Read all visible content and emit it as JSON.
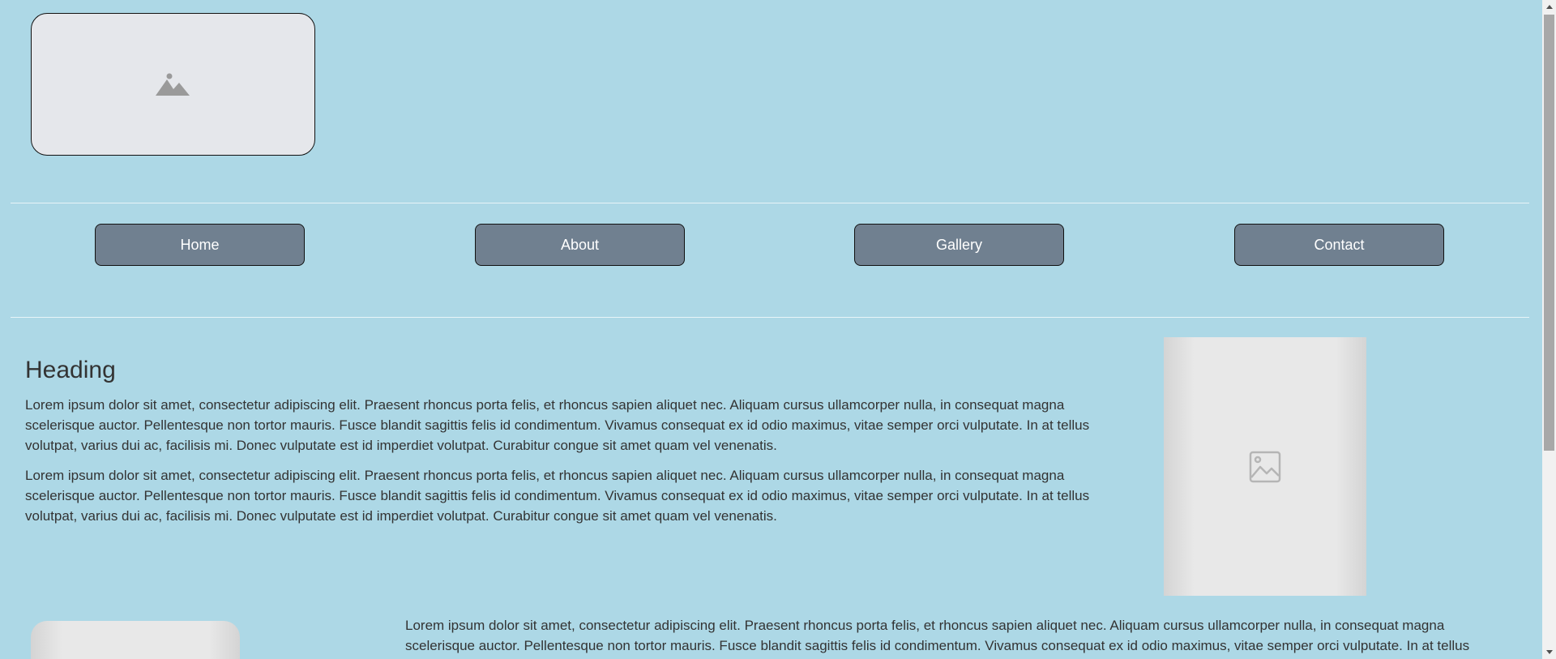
{
  "header": {
    "logo_icon": "mountain-image-placeholder-icon"
  },
  "nav": {
    "items": [
      {
        "label": "Home"
      },
      {
        "label": "About"
      },
      {
        "label": "Gallery"
      },
      {
        "label": "Contact"
      }
    ]
  },
  "main": {
    "heading": "Heading",
    "paragraphs": [
      "Lorem ipsum dolor sit amet, consectetur adipiscing elit. Praesent rhoncus porta felis, et rhoncus sapien aliquet nec. Aliquam cursus ullamcorper nulla, in consequat magna scelerisque auctor. Pellentesque non tortor mauris. Fusce blandit sagittis felis id condimentum. Vivamus consequat ex id odio maximus, vitae semper orci vulputate. In at tellus volutpat, varius dui ac, facilisis mi. Donec vulputate est id imperdiet volutpat. Curabitur congue sit amet quam vel venenatis.",
      "Lorem ipsum dolor sit amet, consectetur adipiscing elit. Praesent rhoncus porta felis, et rhoncus sapien aliquet nec. Aliquam cursus ullamcorper nulla, in consequat magna scelerisque auctor. Pellentesque non tortor mauris. Fusce blandit sagittis felis id condimentum. Vivamus consequat ex id odio maximus, vitae semper orci vulputate. In at tellus volutpat, varius dui ac, facilisis mi. Donec vulputate est id imperdiet volutpat. Curabitur congue sit amet quam vel venenatis."
    ],
    "side_image_icon": "image-placeholder-icon"
  },
  "lower": {
    "paragraph": "Lorem ipsum dolor sit amet, consectetur adipiscing elit. Praesent rhoncus porta felis, et rhoncus sapien aliquet nec. Aliquam cursus ullamcorper nulla, in consequat magna scelerisque auctor. Pellentesque non tortor mauris. Fusce blandit sagittis felis id condimentum. Vivamus consequat ex id odio maximus, vitae semper orci vulputate. In at tellus"
  },
  "colors": {
    "background": "#add8e6",
    "nav_button": "#708090",
    "placeholder": "#e5e7eb"
  }
}
